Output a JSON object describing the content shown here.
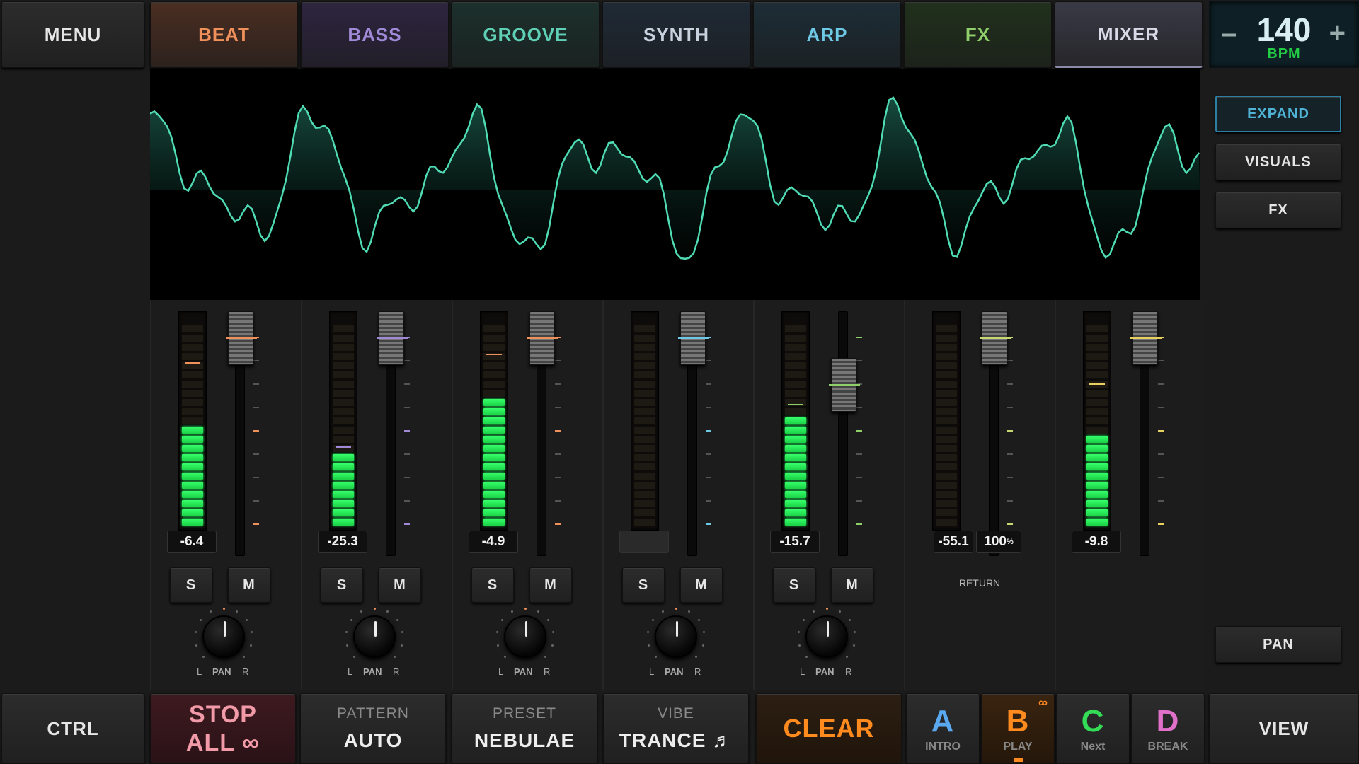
{
  "header": {
    "menu_label": "MENU",
    "tabs": [
      {
        "label": "BEAT",
        "color": "#f0905a",
        "bg": "#4a2e22"
      },
      {
        "label": "BASS",
        "color": "#a08ad8",
        "bg": "#2e2540"
      },
      {
        "label": "GROOVE",
        "color": "#5fcfb5",
        "bg": "#1c302c"
      },
      {
        "label": "SYNTH",
        "color": "#c9d3e0",
        "bg": "#1f2a36"
      },
      {
        "label": "ARP",
        "color": "#6ec8e6",
        "bg": "#1d2d36"
      },
      {
        "label": "FX",
        "color": "#8fd06a",
        "bg": "#21301c"
      },
      {
        "label": "MIXER",
        "color": "#d8dae8",
        "bg": "#3a3a46"
      }
    ],
    "bpm": {
      "minus": "–",
      "value": "140",
      "plus": "+",
      "label": "BPM"
    }
  },
  "side": {
    "expand": "EXPAND",
    "visuals": "VISUALS",
    "fx": "FX",
    "pan": "PAN"
  },
  "mixer": {
    "strips": [
      {
        "readout": "-6.4",
        "level": 0.5,
        "peak": 0.78,
        "color": "#f0905a",
        "fader": 0.0,
        "solo": "S",
        "mute": "M",
        "pan": 0.0,
        "has_controls": true
      },
      {
        "readout": "-25.3",
        "level": 0.36,
        "peak": 0.38,
        "color": "#a08ad8",
        "fader": 0.0,
        "solo": "S",
        "mute": "M",
        "pan": 0.0,
        "has_controls": true
      },
      {
        "readout": "-4.9",
        "level": 0.64,
        "peak": 0.82,
        "color": "#f0905a",
        "fader": 0.0,
        "solo": "S",
        "mute": "M",
        "pan": 0.0,
        "has_controls": true
      },
      {
        "readout": "",
        "level": 0.0,
        "peak": null,
        "color": "#6ec8e6",
        "fader": 0.0,
        "solo": "S",
        "mute": "M",
        "pan": 0.0,
        "has_controls": true
      },
      {
        "readout": "-15.7",
        "level": 0.55,
        "peak": 0.58,
        "color": "#8fd06a",
        "fader": 0.3,
        "solo": "S",
        "mute": "M",
        "pan": 0.0,
        "has_controls": true
      },
      {
        "readout": "-55.1",
        "readout2": "100",
        "readout2_unit": "%",
        "level": 0.0,
        "peak": null,
        "color": "#c8d870",
        "fader": 0.0,
        "return_label": "RETURN",
        "has_controls": false
      },
      {
        "readout": "-9.8",
        "level": 0.46,
        "peak": 0.68,
        "color": "#e8d060",
        "fader": 0.0,
        "has_controls": false
      }
    ],
    "pan_l": "L",
    "pan_word": "PAN",
    "pan_r": "R"
  },
  "footer": {
    "ctrl": "CTRL",
    "stop_line1": "STOP",
    "stop_line2": "ALL ∞",
    "pattern": {
      "label": "PATTERN",
      "value": "AUTO"
    },
    "preset": {
      "label": "PRESET",
      "value": "NEBULAE"
    },
    "vibe": {
      "label": "VIBE",
      "value": "TRANCE ♬"
    },
    "clear": "CLEAR",
    "scenes": [
      {
        "letter": "A",
        "sub": "INTRO",
        "color": "#5aa8f0"
      },
      {
        "letter": "B",
        "sub": "PLAY",
        "color": "#ff8a1e",
        "active": true
      },
      {
        "letter": "C",
        "sub": "Next",
        "color": "#33dd55"
      },
      {
        "letter": "D",
        "sub": "BREAK",
        "color": "#e070c8"
      }
    ],
    "view": "VIEW"
  }
}
